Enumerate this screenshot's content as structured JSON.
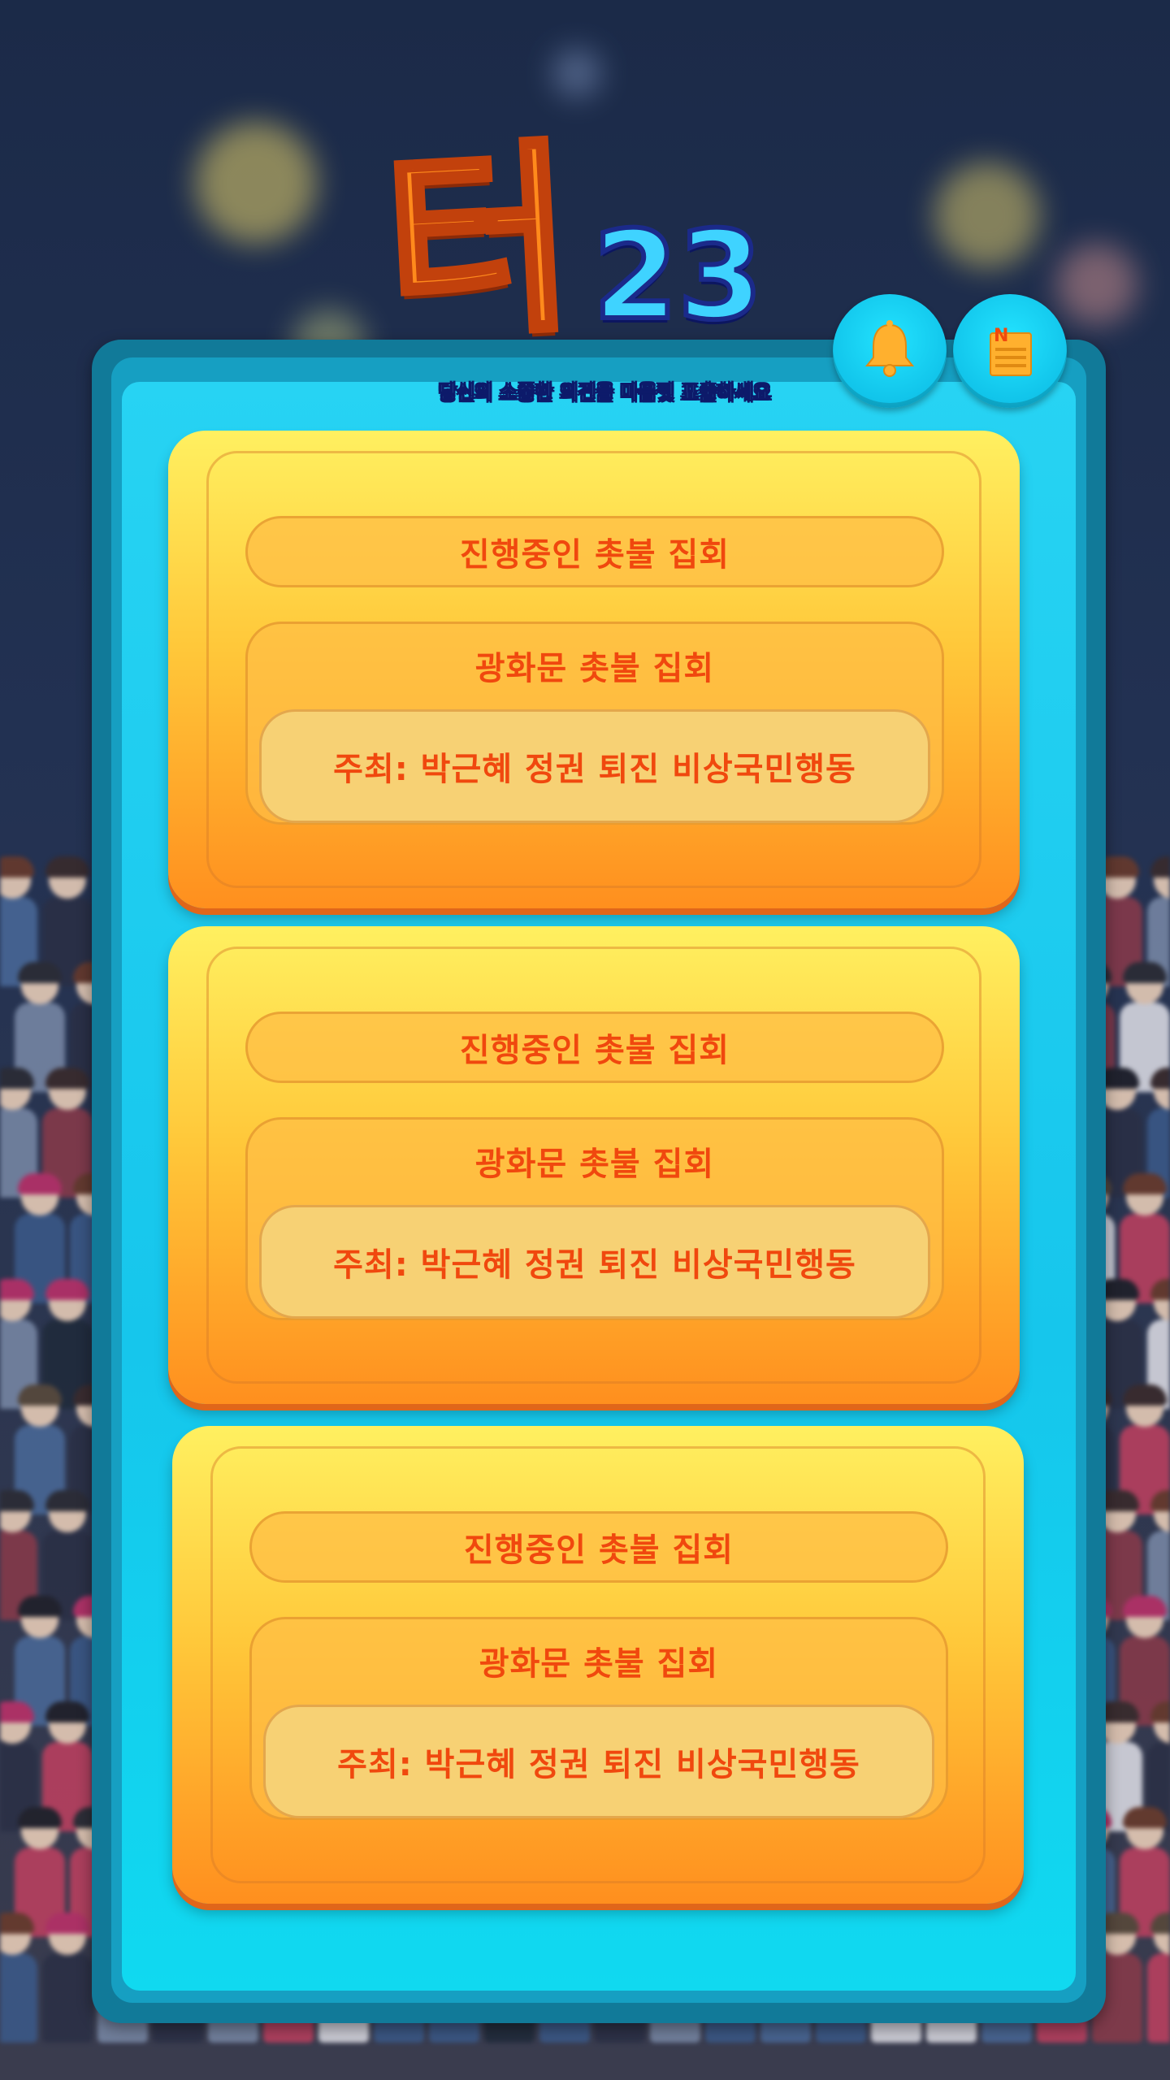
{
  "app": {
    "logo_main": "터",
    "logo_number": "23",
    "tagline": "당신의 소중한 의견을 마음껏 표출하세요"
  },
  "header_buttons": {
    "notification_icon": "bell-icon",
    "news_icon": "news-icon",
    "news_badge": "N"
  },
  "rally_cards": [
    {
      "status": "진행중인 촛불 집회",
      "title": "광화문 촛불 집회",
      "host": "주최: 박근혜 정권 퇴진 비상국민행동"
    },
    {
      "status": "진행중인 촛불 집회",
      "title": "광화문 촛불 집회",
      "host": "주최: 박근혜 정권 퇴진 비상국민행동"
    },
    {
      "status": "진행중인 촛불 집회",
      "title": "광화문 촛불 집회",
      "host": "주최: 박근혜 정권 퇴진 비상국민행동"
    }
  ],
  "colors": {
    "panel": "#16c6ec",
    "card_top": "#fff060",
    "card_bottom": "#ff8f1e",
    "text": "#f0480e",
    "bell": "#ffb02e"
  }
}
